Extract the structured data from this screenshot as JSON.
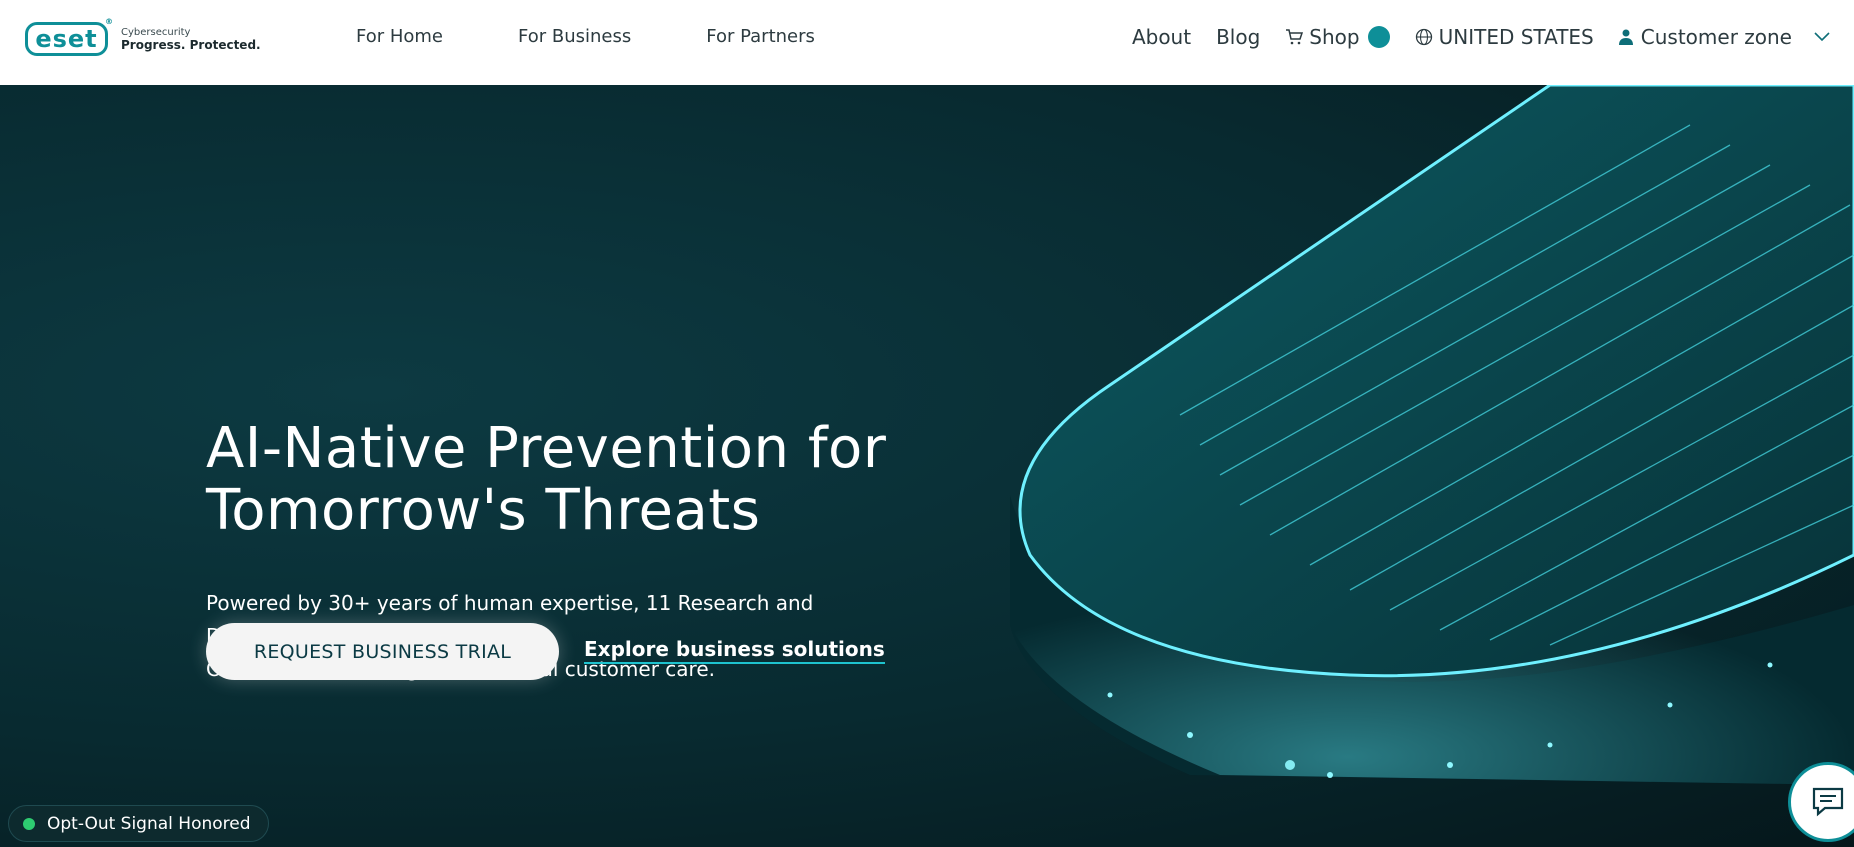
{
  "logo": {
    "mark": "eset",
    "reg": "®",
    "line1": "Cybersecurity",
    "line2": "Progress. Protected."
  },
  "nav": {
    "main": [
      "For Home",
      "For Business",
      "For Partners"
    ],
    "about": "About",
    "blog": "Blog",
    "shop": "Shop",
    "region": "UNITED STATES",
    "customer_zone": "Customer zone"
  },
  "hero": {
    "title_line1": "AI-Native Prevention for",
    "title_line2": "Tomorrow's Threats",
    "subtitle_line1": "Powered by 30+ years of human expertise, 11 Research and Development",
    "subtitle_line2": "Centers around the globe and local customer care.",
    "cta_primary": "REQUEST BUSINESS TRIAL",
    "cta_secondary": "Explore business solutions"
  },
  "optout": {
    "label": "Opt-Out Signal Honored"
  },
  "colors": {
    "brand": "#0e8f98",
    "hero_bg": "#082a30",
    "status_green": "#2ecc71"
  },
  "icons": [
    "cart-icon",
    "globe-icon",
    "user-icon",
    "chevron-down-icon",
    "chat-icon"
  ]
}
